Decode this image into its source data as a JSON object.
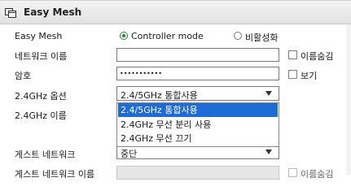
{
  "header": {
    "title": "Easy Mesh",
    "icon": "window-icon"
  },
  "rows": {
    "easy_mesh": {
      "label": "Easy Mesh",
      "option_controller": "Controller mode",
      "option_disable": "비활성화"
    },
    "network_name": {
      "label": "네트워크 이름",
      "hide_label": "이름숨김"
    },
    "password": {
      "label": "암호",
      "value": "•••••••••••",
      "show_label": "보기"
    },
    "band_option": {
      "label": "2.4GHz 옵션",
      "selected": "2.4/5GHz 통합사용"
    },
    "band_name": {
      "label": "2.4GHz 이름"
    },
    "guest_network": {
      "label": "게스트 네트워크",
      "selected": "중단"
    },
    "guest_network_name": {
      "label": "게스트 네트워크 이름",
      "hide_label": "이름숨김"
    }
  },
  "dropdown": {
    "options": [
      "2.4/5GHz 통합사용",
      "2.4GHz 무선 분리 사용",
      "2.4GHz 무선 끄기"
    ],
    "highlighted_index": 0
  },
  "colors": {
    "accent_radio": "#1a8a2e",
    "highlight": "#1e6bd6"
  }
}
